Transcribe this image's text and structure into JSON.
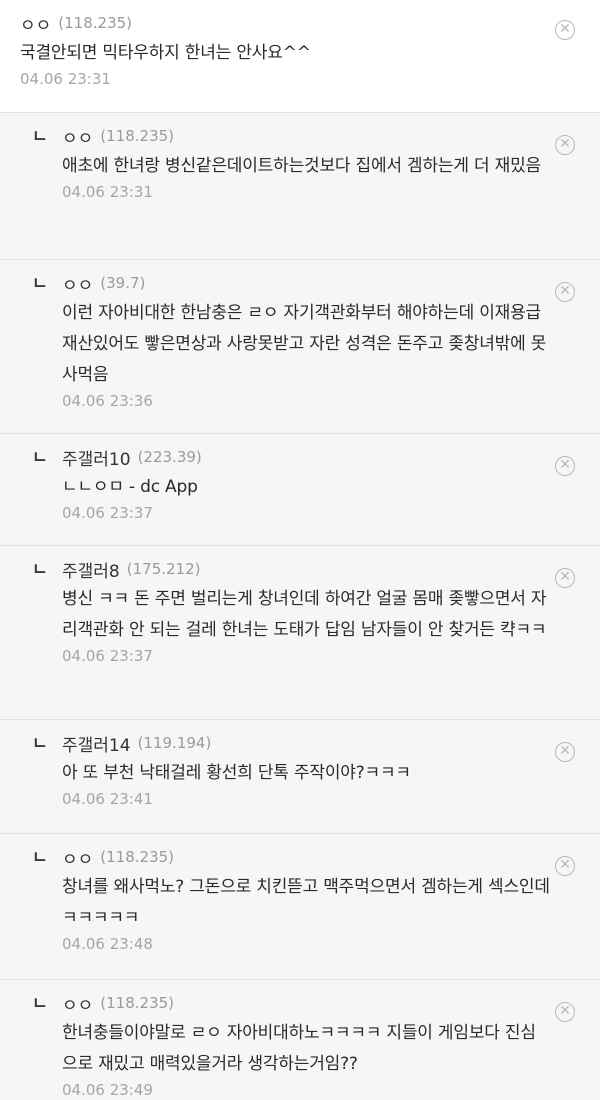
{
  "comments": [
    {
      "nick": "ㅇㅇ",
      "ip": "118.235",
      "text": "국결안되면 믹타우하지 한녀는 안사요^^",
      "date": "04.06 23:31"
    },
    {
      "nick": "ㅇㅇ",
      "ip": "118.235",
      "text": "애초에 한녀랑 병신같은데이트하는것보다 집에서 겜하는게 더 재밌음",
      "date": "04.06 23:31"
    },
    {
      "nick": "ㅇㅇ",
      "ip": "39.7",
      "text": "이런 자아비대한 한남충은 ㄹㅇ 자기객관화부터 해야하는데 이재용급 재산있어도 빻은면상과 사랑못받고 자란 성격은 돈주고 좆창녀밖에 못사먹음",
      "date": "04.06 23:36"
    },
    {
      "nick": "주갤러",
      "nick_num": "10",
      "ip": "223.39",
      "text": "ㄴㄴㅇㅁ - dc App",
      "date": "04.06 23:37"
    },
    {
      "nick": "주갤러",
      "nick_num": "8",
      "ip": "175.212",
      "text": "병신 ㅋㅋ 돈 주면 벌리는게 창녀인데 하여간 얼굴 몸매 좆빻으면서 자리객관화 안 되는 걸레 한녀는 도태가 답임 남자들이 안 찾거든 캭ㅋㅋ",
      "date": "04.06 23:37"
    },
    {
      "nick": "주갤러",
      "nick_num": "14",
      "ip": "119.194",
      "text": "아 또 부천 낙태걸레 황선희 단톡 주작이야?ㅋㅋㅋ",
      "date": "04.06 23:41"
    },
    {
      "nick": "ㅇㅇ",
      "ip": "118.235",
      "text": "창녀를 왜사먹노? 그돈으로 치킨뜯고 맥주먹으면서 겜하는게 섹스인데ㅋㅋㅋㅋㅋ",
      "date": "04.06 23:48"
    },
    {
      "nick": "ㅇㅇ",
      "ip": "118.235",
      "text": "한녀충들이야말로 ㄹㅇ 자아비대하노ㅋㅋㅋㅋ 지들이 게임보다 진심으로 재밌고 매력있을거라 생각하는거임??",
      "date": "04.06 23:49"
    }
  ],
  "icons": {
    "reply_arrow": "ㄴ",
    "delete": "close-circle-icon"
  },
  "colors": {
    "reply_bg": "#f6f6f6",
    "ip": "#9a9a9a",
    "date": "#a5a5a5",
    "divider": "#e2e2e2"
  }
}
